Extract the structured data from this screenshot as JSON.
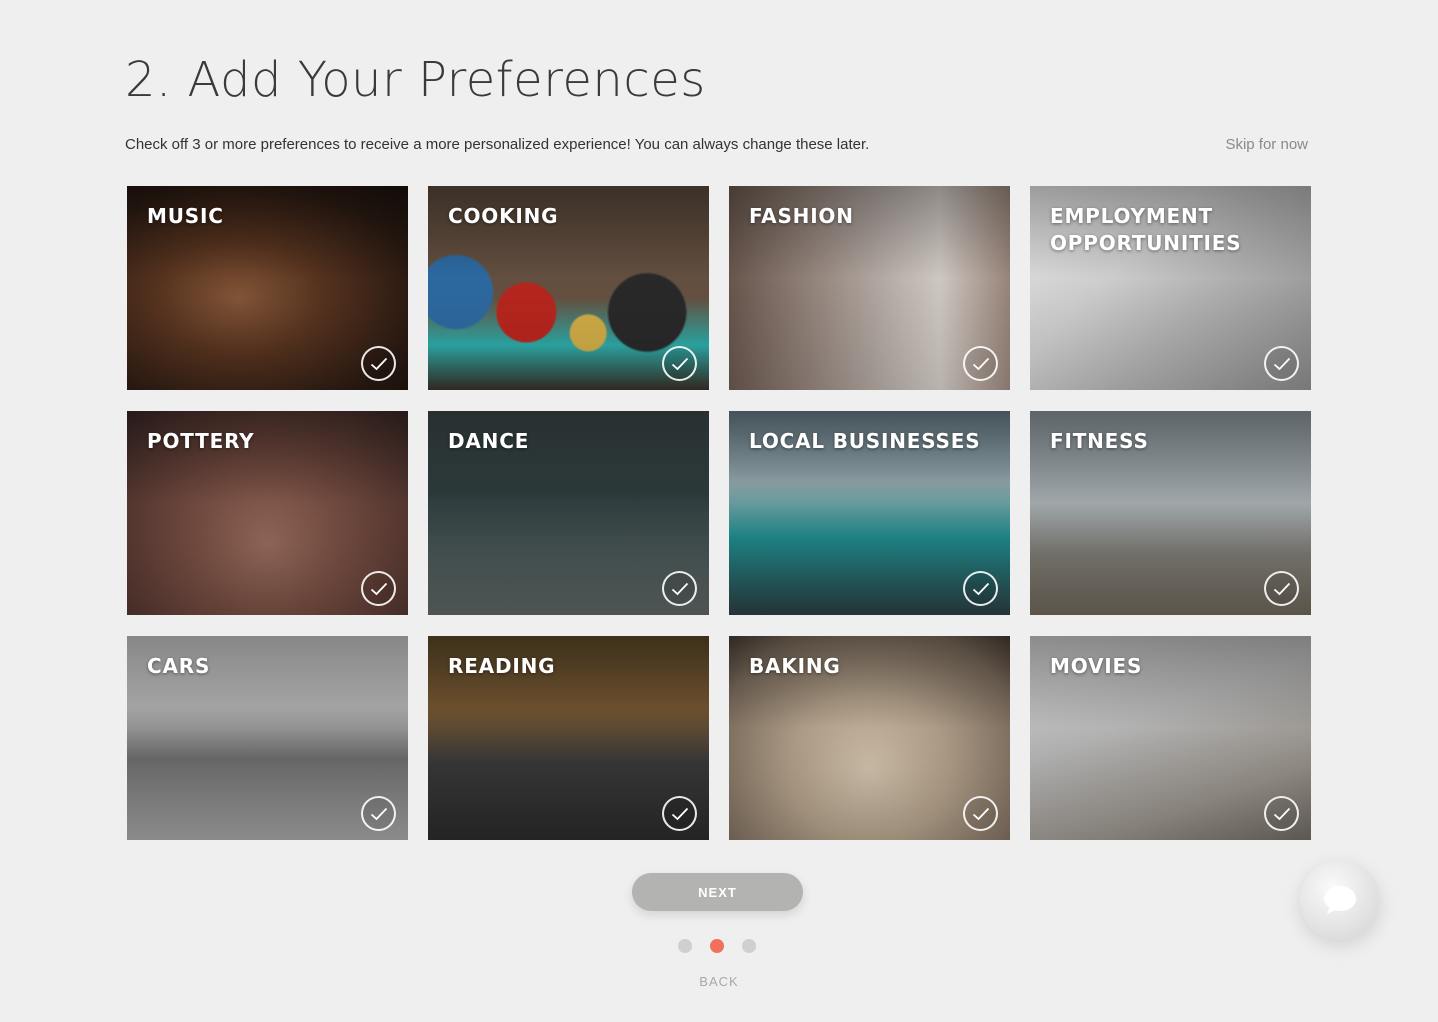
{
  "header": {
    "title": "2. Add Your Preferences",
    "subtitle": "Check off 3 or more preferences to receive a more personalized experience! You can always change these later.",
    "skip_label": "Skip for now"
  },
  "preferences": [
    {
      "label": "MUSIC",
      "checked": false
    },
    {
      "label": "COOKING",
      "checked": false
    },
    {
      "label": "FASHION",
      "checked": false
    },
    {
      "label": "EMPLOYMENT OPPORTUNITIES",
      "checked": false
    },
    {
      "label": "POTTERY",
      "checked": false
    },
    {
      "label": "DANCE",
      "checked": false
    },
    {
      "label": "LOCAL BUSINESSES",
      "checked": false
    },
    {
      "label": "FITNESS",
      "checked": false
    },
    {
      "label": "CARS",
      "checked": false
    },
    {
      "label": "READING",
      "checked": false
    },
    {
      "label": "BAKING",
      "checked": false
    },
    {
      "label": "MOVIES",
      "checked": false
    }
  ],
  "footer": {
    "next_label": "NEXT",
    "back_label": "BACK",
    "steps": 3,
    "current_step": 2
  },
  "colors": {
    "background": "#efefef",
    "active_dot": "#f2705a",
    "inactive_dot": "#cfcfcf",
    "next_button": "#b3b3b1"
  },
  "icons": {
    "card_check": "check-circle-icon",
    "chat": "chat-bubble-icon"
  }
}
